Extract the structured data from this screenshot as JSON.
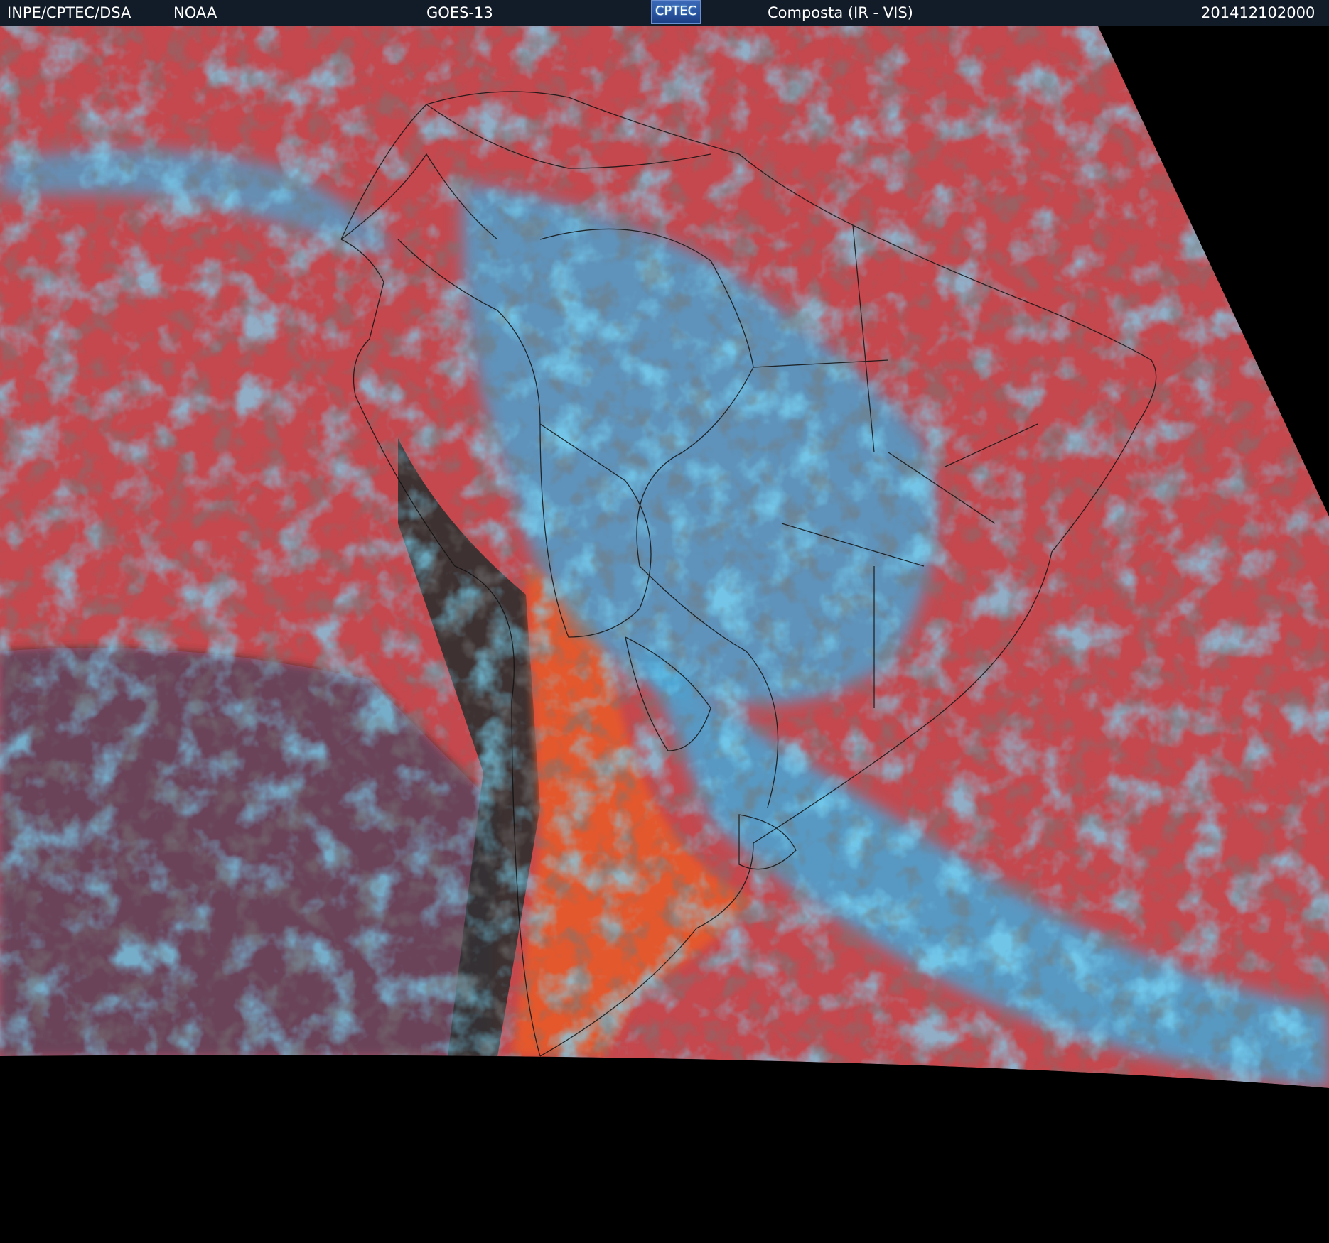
{
  "header": {
    "source_left": "INPE/CPTEC/DSA",
    "agency": "NOAA",
    "satellite": "GOES-13",
    "logo_text": "CPTEC",
    "product": "Composta (IR - VIS)",
    "timestamp": "201412102000"
  },
  "colors": {
    "header_bg": "#121b28",
    "ocean_clear": "#c94a45",
    "land_clear": "#e85a2a",
    "high_cloud": "#35b4ea",
    "low_cloud": "#2f2f2f",
    "night_side": "#5a5a5a",
    "no_data": "#000000",
    "border_lines": "#111111"
  }
}
